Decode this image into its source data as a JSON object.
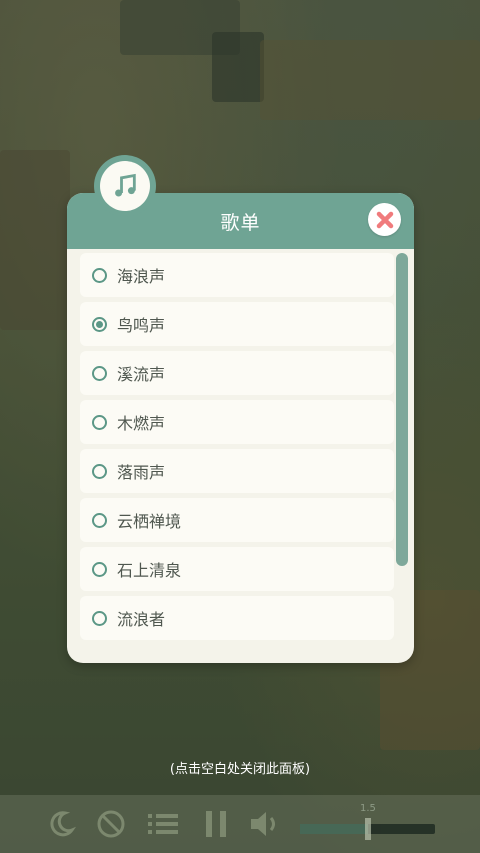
{
  "panel": {
    "title": "歌单",
    "items": [
      {
        "label": "海浪声",
        "selected": false
      },
      {
        "label": "鸟鸣声",
        "selected": true
      },
      {
        "label": "溪流声",
        "selected": false
      },
      {
        "label": "木燃声",
        "selected": false
      },
      {
        "label": "落雨声",
        "selected": false
      },
      {
        "label": "云栖禅境",
        "selected": false
      },
      {
        "label": "石上清泉",
        "selected": false
      },
      {
        "label": "流浪者",
        "selected": false
      }
    ]
  },
  "hint": "(点击空白处关闭此面板)",
  "controls": {
    "volume_value": "1.5",
    "volume_level": 0.5,
    "icons": [
      "moon-icon",
      "no-entry-icon",
      "playlist-icon",
      "pause-icon",
      "speaker-icon"
    ]
  },
  "colors": {
    "header": "#6fa494",
    "close_x": "#f07b7d",
    "radio": "#5b9786"
  }
}
